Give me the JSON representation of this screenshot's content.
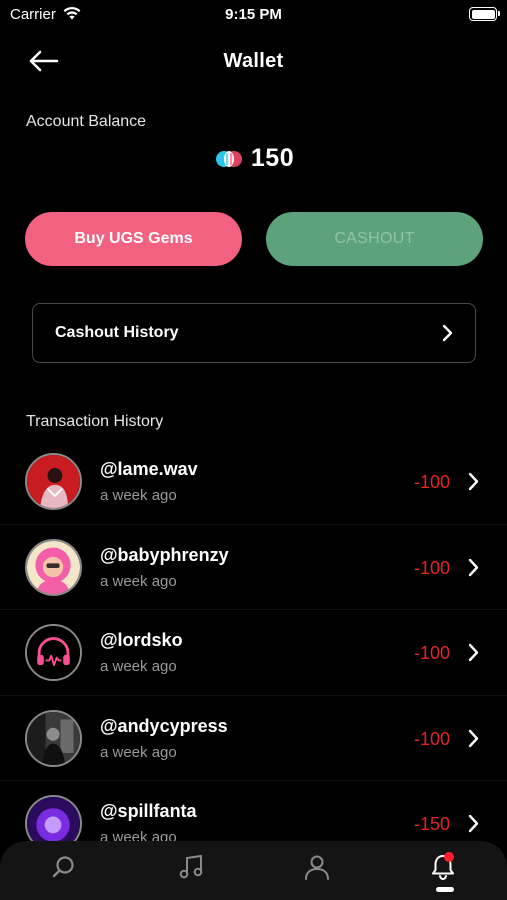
{
  "status": {
    "carrier": "Carrier",
    "time": "9:15 PM"
  },
  "header": {
    "title": "Wallet"
  },
  "balance": {
    "label": "Account Balance",
    "value": "150"
  },
  "actions": {
    "buy_label": "Buy UGS Gems",
    "cashout_label": "CASHOUT"
  },
  "cashout_history": {
    "label": "Cashout History"
  },
  "transactions": {
    "heading": "Transaction History",
    "items": [
      {
        "handle": "@lame.wav",
        "time": "a week ago",
        "amount": "-100"
      },
      {
        "handle": "@babyphrenzy",
        "time": "a week ago",
        "amount": "-100"
      },
      {
        "handle": "@lordsko",
        "time": "a week ago",
        "amount": "-100"
      },
      {
        "handle": "@andycypress",
        "time": "a week ago",
        "amount": "-100"
      },
      {
        "handle": "@spillfanta",
        "time": "a week ago",
        "amount": "-150"
      }
    ]
  },
  "tab_bar": {
    "tabs": [
      "search-icon",
      "music-note-icon",
      "profile-icon",
      "bell-icon"
    ],
    "active": "bell-icon"
  },
  "colors": {
    "accent_pink": "#f2617f",
    "cashout_green": "#5da27a",
    "negative_red": "#e02525",
    "notification_dot": "#ff1f2d"
  }
}
